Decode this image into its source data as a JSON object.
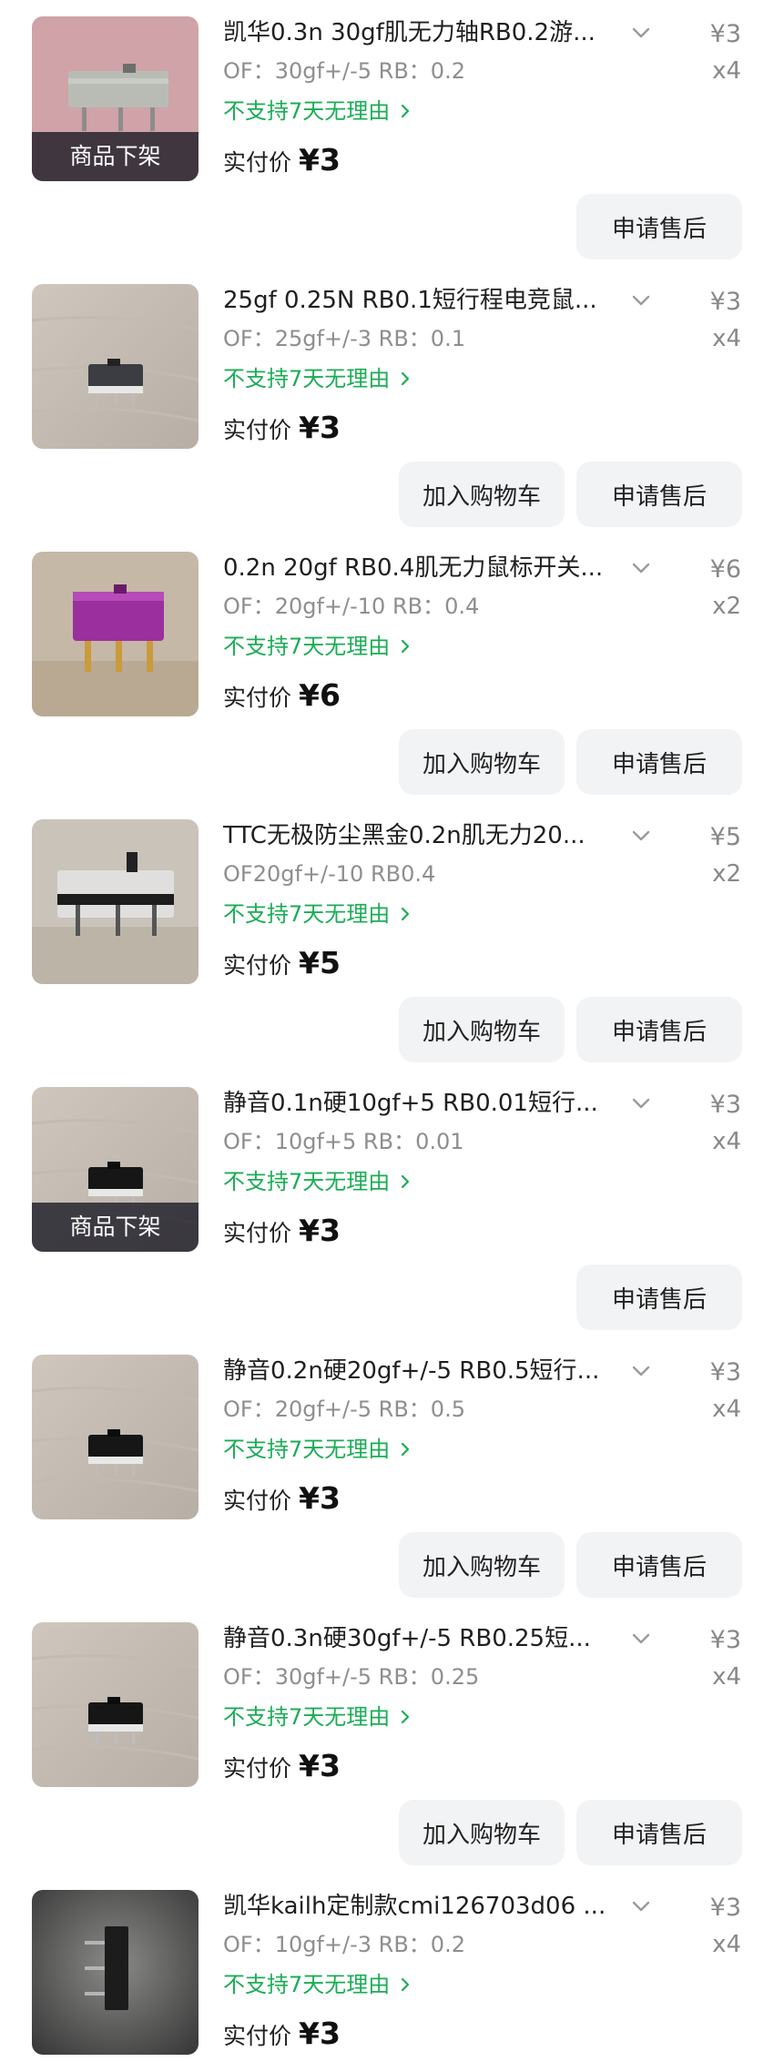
{
  "labels": {
    "delisted": "商品下架",
    "no_return": "不支持7天无理由",
    "paid": "实付价",
    "add_cart": "加入购物车",
    "after_sale": "申请售后"
  },
  "colors": {
    "accent_green": "#1aad54",
    "button_bg": "#f2f3f5",
    "muted_text": "#8e8e8e"
  },
  "orders": [
    {
      "title": "凯华0.3n 30gf肌无力轴RB0.2游...",
      "spec": "OF：30gf+/-5 RB：0.2",
      "price": "¥3",
      "qty": "x4",
      "paid": "¥3",
      "delisted": true,
      "has_cart": false,
      "image_icon": "gray-switch-on-pink-fabric"
    },
    {
      "title": "25gf 0.25N RB0.1短行程电竞鼠...",
      "spec": "OF：25gf+/-3 RB：0.1",
      "price": "¥3",
      "qty": "x4",
      "paid": "¥3",
      "delisted": false,
      "has_cart": true,
      "image_icon": "small-black-switch-on-wood"
    },
    {
      "title": "0.2n 20gf RB0.4肌无力鼠标开关...",
      "spec": "OF：20gf+/-10 RB：0.4",
      "price": "¥6",
      "qty": "x2",
      "paid": "¥6",
      "delisted": false,
      "has_cart": true,
      "image_icon": "purple-switch-gold-pins"
    },
    {
      "title": "TTC无极防尘黑金0.2n肌无力20...",
      "spec": "OF20gf+/-10 RB0.4",
      "price": "¥5",
      "qty": "x2",
      "paid": "¥5",
      "delisted": false,
      "has_cart": true,
      "image_icon": "transparent-black-switch"
    },
    {
      "title": "静音0.1n硬10gf+5 RB0.01短行...",
      "spec": "OF：10gf+5 RB：0.01",
      "price": "¥3",
      "qty": "x4",
      "paid": "¥3",
      "delisted": true,
      "has_cart": false,
      "image_icon": "black-micro-switch-on-wood"
    },
    {
      "title": "静音0.2n硬20gf+/-5 RB0.5短行...",
      "spec": "OF：20gf+/-5 RB：0.5",
      "price": "¥3",
      "qty": "x4",
      "paid": "¥3",
      "delisted": false,
      "has_cart": true,
      "image_icon": "black-micro-switch-on-wood"
    },
    {
      "title": "静音0.3n硬30gf+/-5 RB0.25短...",
      "spec": "OF：30gf+/-5 RB：0.25",
      "price": "¥3",
      "qty": "x4",
      "paid": "¥3",
      "delisted": false,
      "has_cart": true,
      "image_icon": "black-micro-switch-on-wood"
    },
    {
      "title": "凯华kailh定制款cmi126703d06 ...",
      "spec": "OF：10gf+/-3 RB：0.2",
      "price": "¥3",
      "qty": "x4",
      "paid": "¥3",
      "delisted": false,
      "has_cart": false,
      "image_icon": "side-view-switch-dark-background"
    }
  ]
}
